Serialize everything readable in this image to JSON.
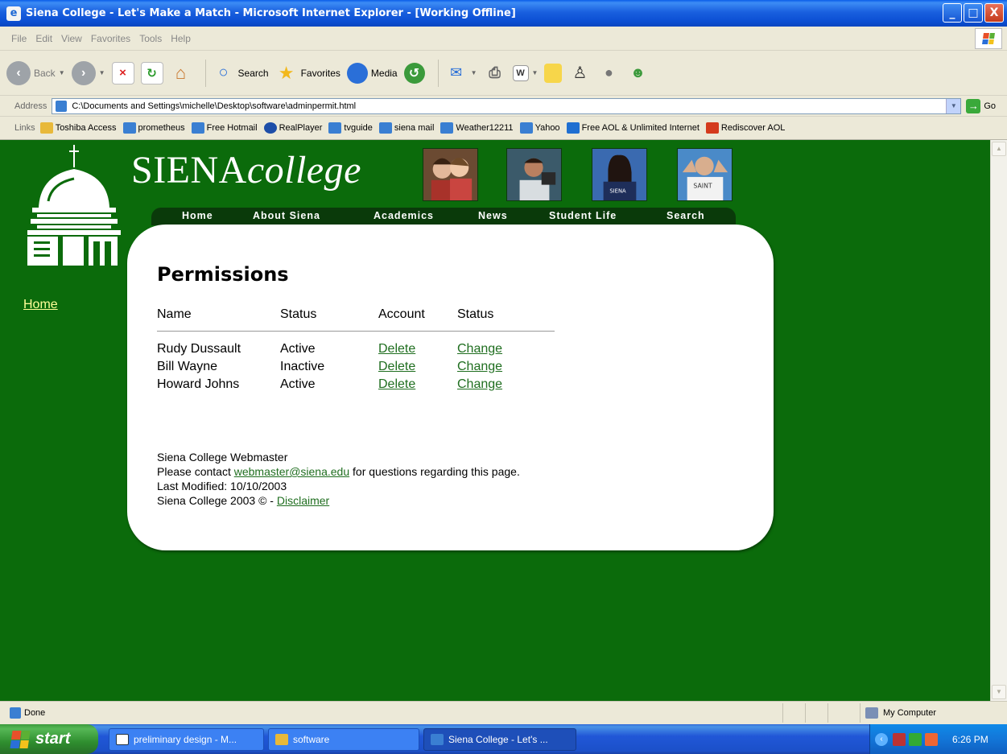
{
  "window": {
    "title": "Siena College - Let's Make a Match - Microsoft Internet Explorer - [Working Offline]",
    "minimize": "_",
    "maximize": "□",
    "close": "X"
  },
  "menu": [
    "File",
    "Edit",
    "View",
    "Favorites",
    "Tools",
    "Help"
  ],
  "toolbar": {
    "back": "Back",
    "search": "Search",
    "favorites": "Favorites",
    "media": "Media"
  },
  "address": {
    "label": "Address",
    "value": "C:\\Documents and Settings\\michelle\\Desktop\\software\\adminpermit.html",
    "go": "Go"
  },
  "links": {
    "label": "Links",
    "items": [
      {
        "label": "Toshiba Access",
        "icon": "folder-icon",
        "color": "#e8b93a"
      },
      {
        "label": "prometheus",
        "icon": "ie-page-icon",
        "color": "#3a7fd2"
      },
      {
        "label": "Free Hotmail",
        "icon": "ie-page-icon",
        "color": "#3a7fd2"
      },
      {
        "label": "RealPlayer",
        "icon": "realplayer-icon",
        "color": "#1d4ea8"
      },
      {
        "label": "tvguide",
        "icon": "ie-page-icon",
        "color": "#3a7fd2"
      },
      {
        "label": "siena mail",
        "icon": "ie-page-icon",
        "color": "#3a7fd2"
      },
      {
        "label": "Weather12211",
        "icon": "ie-page-icon",
        "color": "#3a7fd2"
      },
      {
        "label": "Yahoo",
        "icon": "ie-page-icon",
        "color": "#3a7fd2"
      },
      {
        "label": "Free AOL & Unlimited Internet",
        "icon": "aol-icon",
        "color": "#1f6fd1"
      },
      {
        "label": "Rediscover AOL",
        "icon": "aol-red-icon",
        "color": "#d43a1c"
      }
    ]
  },
  "site": {
    "brand_main": "SIENA",
    "brand_italic": "college",
    "nav": [
      "Home",
      "About Siena",
      "Academics",
      "News",
      "Student Life",
      "Search"
    ],
    "left_home": "Home"
  },
  "content": {
    "heading": "Permissions",
    "columns": [
      "Name",
      "Status",
      "Account",
      "Status"
    ],
    "rows": [
      {
        "name": "Rudy Dussault",
        "status": "Active",
        "account": "Delete",
        "change": "Change"
      },
      {
        "name": "Bill Wayne",
        "status": "Inactive",
        "account": "Delete",
        "change": "Change"
      },
      {
        "name": "Howard Johns",
        "status": "Active",
        "account": "Delete",
        "change": "Change"
      }
    ],
    "footer": {
      "webmaster": "Siena College Webmaster",
      "contact_pre": "Please contact ",
      "contact_email": "webmaster@siena.edu",
      "contact_post": " for questions regarding this page.",
      "modified": "Last Modified: 10/10/2003",
      "copyright": "Siena College 2003 © - ",
      "disclaimer": "Disclaimer"
    }
  },
  "statusbar": {
    "text": "Done",
    "zone": "My Computer"
  },
  "taskbar": {
    "start": "start",
    "tasks": [
      "preliminary design - M...",
      "software",
      "Siena College - Let's ..."
    ],
    "clock": "6:26 PM"
  },
  "colors": {
    "page_green": "#0b6b0b",
    "link_green": "#1f6e1f",
    "left_link": "#ffff99"
  }
}
